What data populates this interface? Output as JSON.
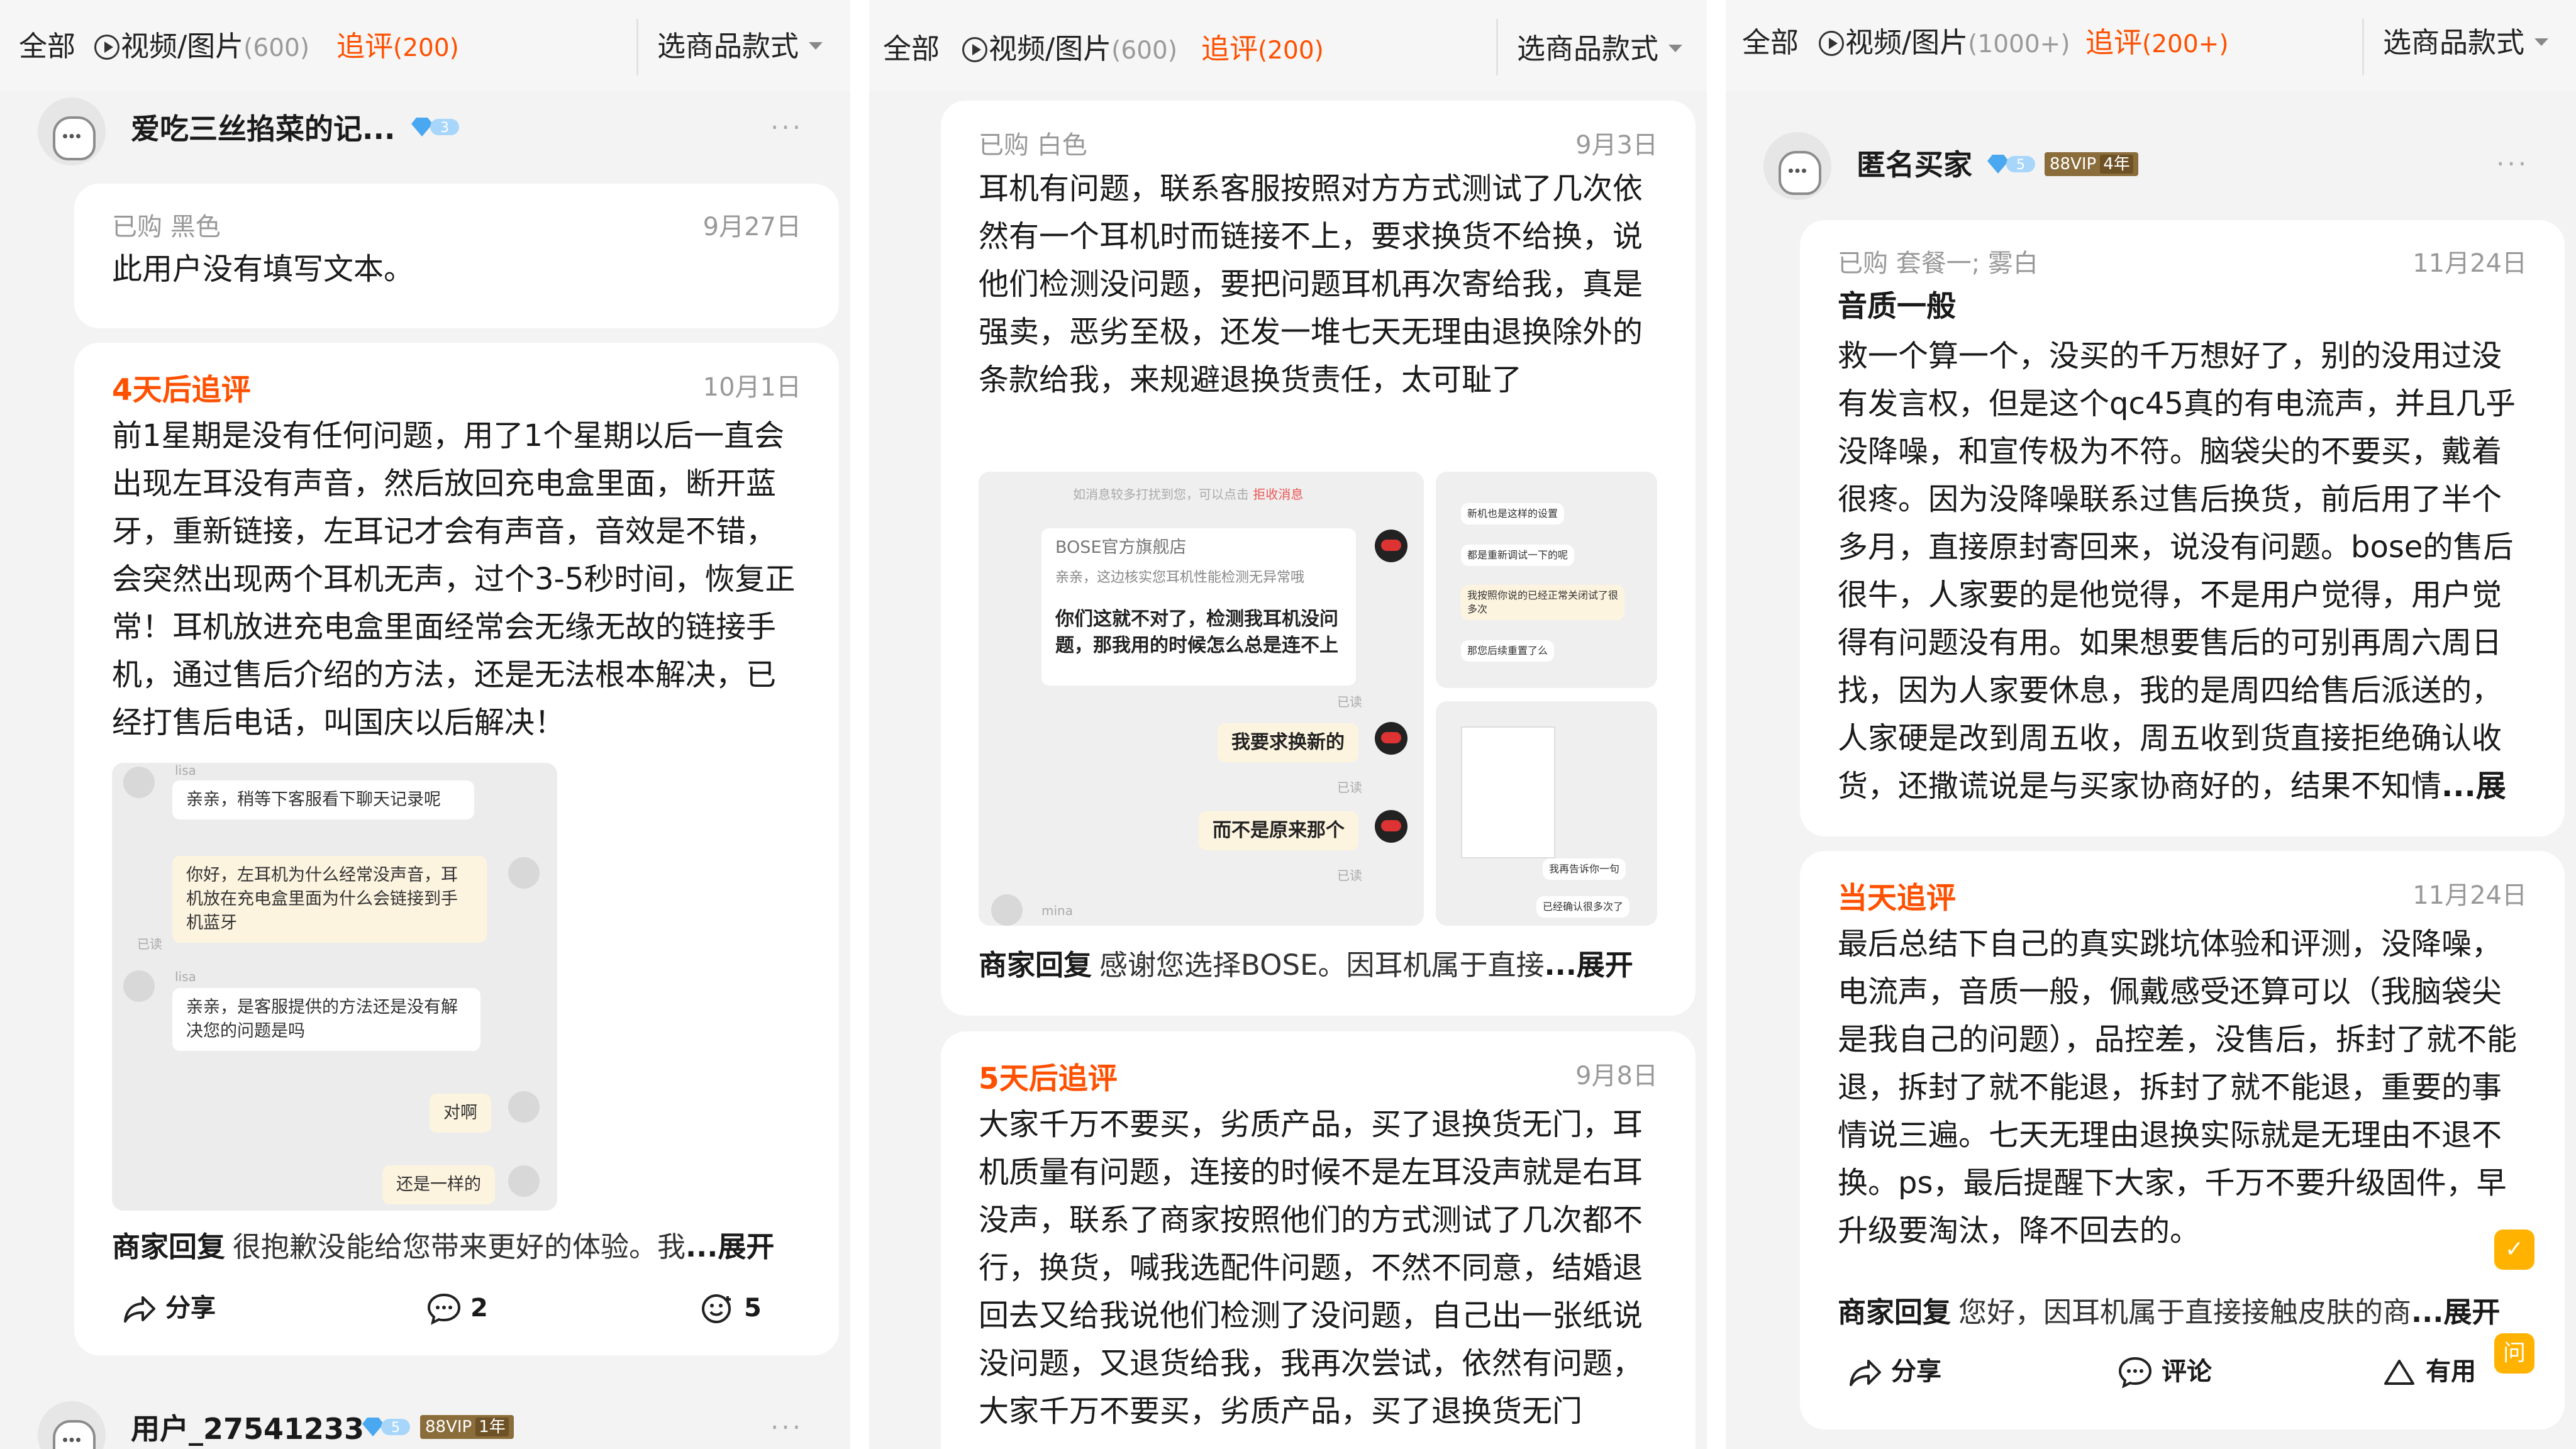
{
  "panels": [
    {
      "tabs": {
        "all": "全部",
        "media": "视频/图片",
        "media_count": "(600)",
        "followup": "追评",
        "followup_count": "(200)",
        "select": "选商品款式"
      },
      "user": {
        "name": "爱吃三丝掐菜的记...",
        "level": "3",
        "more": "···"
      },
      "review": {
        "purchased": "已购 黑色",
        "date": "9月27日",
        "text": "此用户没有填写文本。"
      },
      "followup": {
        "title": "4天后追评",
        "date": "10月1日",
        "text": "前1星期是没有任何问题，用了1个星期以后一直会出现左耳没有声音，然后放回充电盒里面，断开蓝牙，重新链接，左耳记才会有声音，音效是不错，会突然出现两个耳机无声，过个3-5秒时间，恢复正常！耳机放进充电盒里面经常会无缘无故的链接手机，通过售后介绍的方法，还是无法根本解决，已经打售后电话，叫国庆以后解决！"
      },
      "chat": {
        "name1": "lisa",
        "msg1": "亲亲，稍等下客服看下聊天记录呢",
        "msg2": "你好，左耳机为什么经常没声音，耳机放在充电盒里面为什么会链接到手机蓝牙",
        "read": "已读",
        "name2": "lisa",
        "msg3": "亲亲，是客服提供的方法还是没有解决您的问题是吗",
        "msg4": "对啊",
        "msg5": "还是一样的"
      },
      "reply": {
        "label": "商家回复",
        "text": "很抱歉没能给您带来更好的体验。我",
        "more": "...展开"
      },
      "actions": {
        "share": "分享",
        "comment": "2",
        "like": "5"
      },
      "user2": {
        "name": "用户_27541233",
        "level": "5",
        "vip": "88VIP",
        "years": "1年",
        "more": "···"
      }
    },
    {
      "tabs": {
        "all": "全部",
        "media": "视频/图片",
        "media_count": "(600)",
        "followup": "追评",
        "followup_count": "(200)",
        "select": "选商品款式"
      },
      "review": {
        "purchased": "已购 白色",
        "date": "9月3日",
        "text": "耳机有问题，联系客服按照对方方式测试了几次依然有一个耳机时而链接不上，要求换货不给换，说他们检测没问题，要把问题耳机再次寄给我，真是强卖，恶劣至极，还发一堆七天无理由退换除外的条款给我，来规避退换货责任，太可耻了"
      },
      "chat": {
        "notice": "如消息较多打扰到您，可以点击",
        "notice_link": "拒收消息",
        "shop": "BOSE官方旗舰店",
        "quote": "亲亲，这边核实您耳机性能检测无异常哦",
        "msg1": "你们这就不对了，检测我耳机没问题，那我用的时候怎么总是连不上",
        "read": "已读",
        "msg2": "我要求换新的",
        "msg3": "而不是原来那个",
        "agent": "mina",
        "side1": "新机也是这样的设置",
        "side2": "都是重新调试一下的呢",
        "side3": "我按照你说的已经正常关闭试了很多次",
        "side4": "那您后续重置了么",
        "side5": "我再告诉你一句",
        "side6": "已经确认很多次了"
      },
      "reply": {
        "label": "商家回复",
        "text": "感谢您选择BOSE。因耳机属于直接",
        "more": "...展开"
      },
      "followup": {
        "title": "5天后追评",
        "date": "9月8日",
        "text": "大家千万不要买，劣质产品，买了退换货无门，耳机质量有问题，连接的时候不是左耳没声就是右耳没声，联系了商家按照他们的方式测试了几次都不行，换货，喊我选配件问题，不然不同意，结婚退回去又给我说他们检测了没问题，自己出一张纸说没问题，又退货给我，我再次尝试，依然有问题，大家千万不要买，劣质产品，买了退换货无门"
      }
    },
    {
      "tabs": {
        "all": "全部",
        "media": "视频/图片",
        "media_count": "(1000+)",
        "followup": "追评",
        "followup_count": "(200+)",
        "select": "选商品款式"
      },
      "user": {
        "name": "匿名买家",
        "level": "5",
        "vip": "88VIP",
        "years": "4年",
        "more": "···"
      },
      "review": {
        "purchased": "已购 套餐一; 雾白",
        "date": "11月24日",
        "headline": "音质一般",
        "text": "救一个算一个，没买的千万想好了，别的没用过没有发言权，但是这个qc45真的有电流声，并且几乎没降噪，和宣传极为不符。脑袋尖的不要买，戴着很疼。因为没降噪联系过售后换货，前后用了半个多月，直接原封寄回来，说没有问题。bose的售后很牛，人家要的是他觉得，不是用户觉得，用户觉得有问题没有用。如果想要售后的可别再周六周日找，因为人家要休息，我的是周四给售后派送的，人家硬是改到周五收，周五收到货直接拒绝确认收货，还撒谎说是与买家协商好的，结果不知情",
        "more": "...展开"
      },
      "followup": {
        "title": "当天追评",
        "date": "11月24日",
        "text": "最后总结下自己的真实跳坑体验和评测，没降噪，电流声，音质一般，佩戴感受还算可以（我脑袋尖是我自己的问题），品控差，没售后，拆封了就不能退，拆封了就不能退，拆封了就不能退，重要的事情说三遍。七天无理由退换实际就是无理由不退不换。ps，最后提醒下大家，千万不要升级固件，早升级要淘汰，降不回去的。"
      },
      "reply": {
        "label": "商家回复",
        "text": "您好，因耳机属于直接接触皮肤的商",
        "more": "...展开"
      },
      "actions": {
        "share": "分享",
        "comment": "评论",
        "useful": "有用"
      },
      "side": {
        "btn1": "✓",
        "btn2": "问"
      }
    }
  ],
  "colors": {
    "accent": "#ff5000",
    "diamond": "#4aa8f0",
    "vip": "#8a6d3b"
  }
}
